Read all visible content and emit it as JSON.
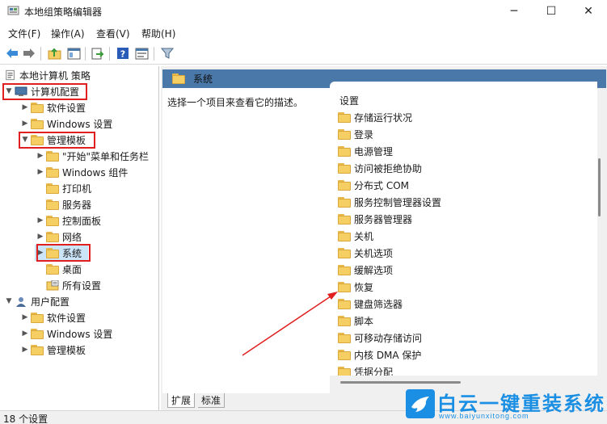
{
  "window": {
    "title": "本地组策略编辑器",
    "minimize": "─",
    "maximize": "☐",
    "close": "✕"
  },
  "menu": [
    "文件(F)",
    "操作(A)",
    "查看(V)",
    "帮助(H)"
  ],
  "tree": {
    "root": "本地计算机 策略",
    "computer_config": "计算机配置",
    "software_settings": "软件设置",
    "windows_settings": "Windows 设置",
    "admin_templates": "管理模板",
    "start_menu": "\"开始\"菜单和任务栏",
    "windows_components": "Windows 组件",
    "printers": "打印机",
    "server": "服务器",
    "control_panel": "控制面板",
    "network": "网络",
    "system": "系统",
    "desktop": "桌面",
    "all_settings": "所有设置",
    "user_config": "用户配置",
    "user_software_settings": "软件设置",
    "user_windows_settings": "Windows 设置",
    "user_admin_templates": "管理模板"
  },
  "header": {
    "title": "系统"
  },
  "description": {
    "text": "选择一个项目来查看它的描述。"
  },
  "list": {
    "column": "设置",
    "items": [
      "存储运行状况",
      "登录",
      "电源管理",
      "访问被拒绝协助",
      "分布式 COM",
      "服务控制管理器设置",
      "服务器管理器",
      "关机",
      "关机选项",
      "缓解选项",
      "恢复",
      "键盘筛选器",
      "脚本",
      "可移动存储访问",
      "内核 DMA 保护",
      "凭据分配"
    ]
  },
  "tabs": {
    "extended": "扩展",
    "standard": "标准"
  },
  "status": {
    "text": "18 个设置"
  },
  "watermark": {
    "title": "白云一键重装系统",
    "url": "www.baiyunxitong.com"
  },
  "colors": {
    "accent": "#4a78a8",
    "highlight": "#e02020",
    "folder": "#f5cf63",
    "brand": "#1a8fe3"
  }
}
